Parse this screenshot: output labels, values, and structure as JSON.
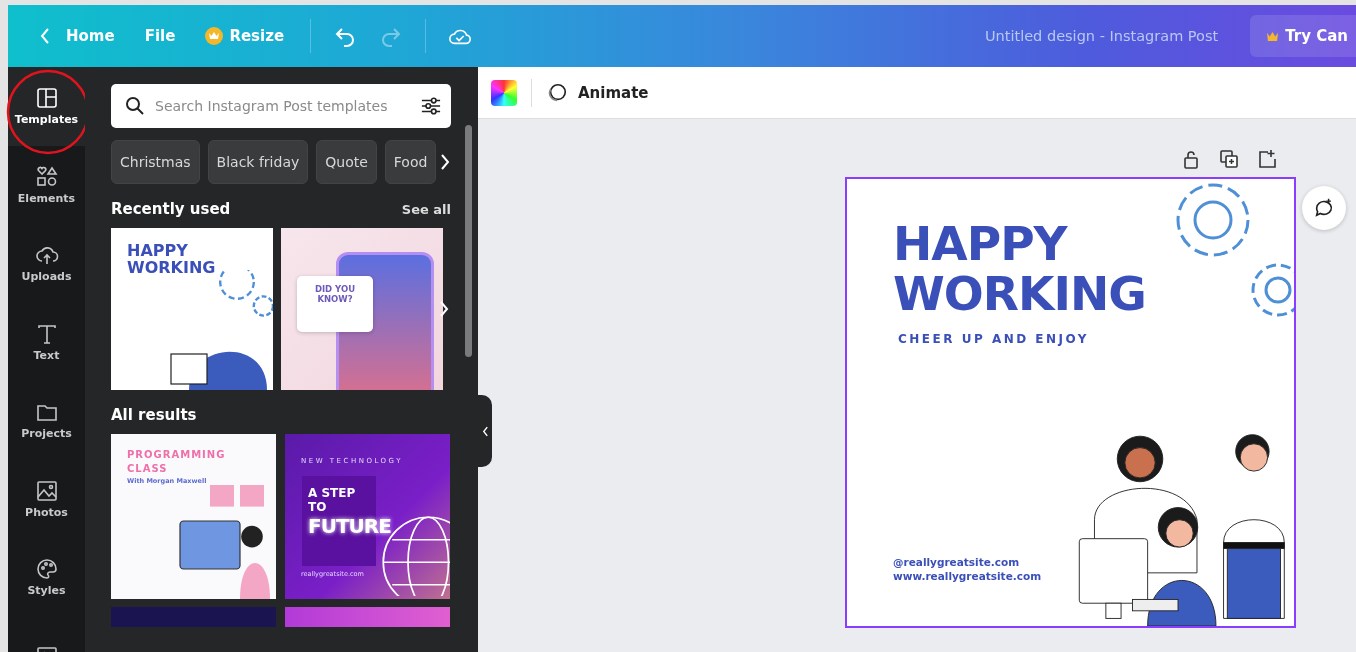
{
  "topbar": {
    "back_label": "Home",
    "menu": [
      {
        "label": "File",
        "kind": "plain"
      },
      {
        "label": "Resize",
        "kind": "premium"
      }
    ],
    "redo_disabled": true,
    "design_title": "Untitled design - Instagram Post",
    "upgrade_label": "Try Can"
  },
  "sidebar": {
    "items": [
      {
        "label": "Templates",
        "kind": "templates",
        "selected": true
      },
      {
        "label": "Elements",
        "kind": "elements",
        "selected": false
      },
      {
        "label": "Uploads",
        "kind": "uploads",
        "selected": false
      },
      {
        "label": "Text",
        "kind": "text",
        "selected": false
      },
      {
        "label": "Projects",
        "kind": "projects",
        "selected": false
      },
      {
        "label": "Photos",
        "kind": "photos",
        "selected": false
      },
      {
        "label": "Styles",
        "kind": "styles",
        "selected": false
      },
      {
        "kind": "video",
        "selected": false
      }
    ]
  },
  "panel": {
    "search": {
      "placeholder": "Search Instagram Post templates"
    },
    "chips": [
      "Christmas",
      "Black friday",
      "Quote",
      "Food"
    ],
    "recent": {
      "title": "Recently used",
      "see_all": "See all",
      "templates": [
        {
          "kind": "happy",
          "texts": [
            "HAPPY WORKING"
          ]
        },
        {
          "kind": "phone",
          "texts": [
            "DID YOU KNOW?"
          ]
        }
      ]
    },
    "results": {
      "title": "All results",
      "templates": [
        {
          "kind": "programming",
          "texts": [
            "PROGRAMMING CLASS",
            "With Morgan Maxwell"
          ]
        },
        {
          "kind": "future",
          "texts": [
            "NEW TECHNOLOGY",
            "A STEP TO",
            "FUTURE",
            "reallygreatsite.com"
          ]
        }
      ]
    }
  },
  "canvas": {
    "animate_label": "Animate",
    "design": {
      "headline": "HAPPY WORKING",
      "tagline": "CHEER UP AND ENJOY",
      "contacts": [
        "@reallygreatsite.com",
        "www.reallygreatsite.com"
      ]
    }
  }
}
